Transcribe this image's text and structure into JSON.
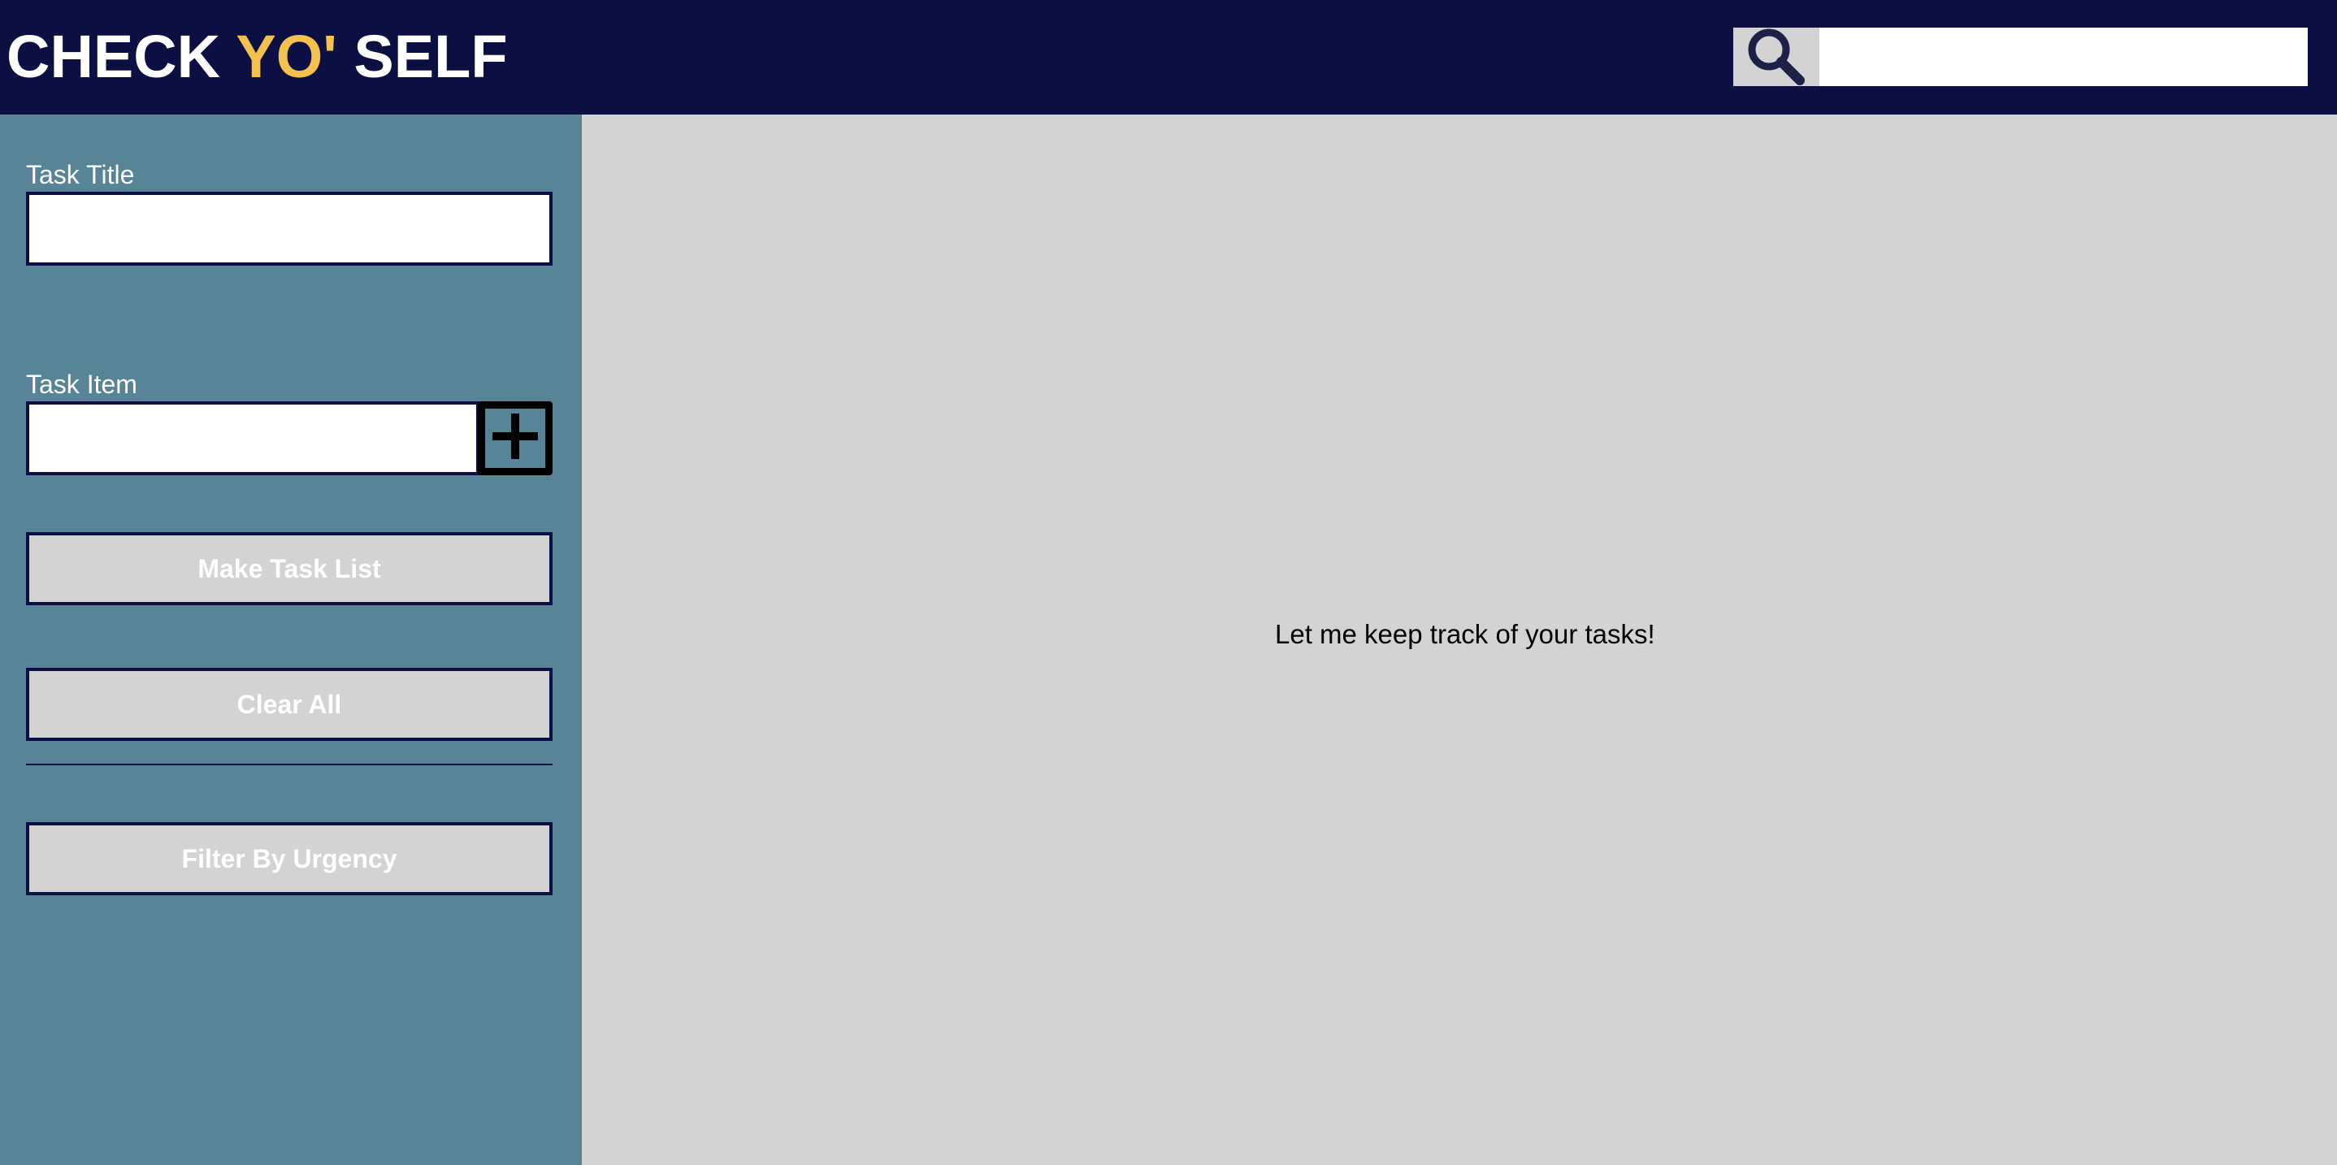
{
  "header": {
    "brand_part1": "CHECK ",
    "brand_accent": "YO'",
    "brand_part2": " SELF",
    "search": {
      "placeholder": "",
      "value": "",
      "icon": "search-icon"
    }
  },
  "sidebar": {
    "task_title_label": "Task Title",
    "task_title_value": "",
    "task_item_label": "Task Item",
    "task_item_value": "",
    "add_item_icon": "plus-icon",
    "make_task_list_label": "Make Task List",
    "clear_all_label": "Clear All",
    "filter_label": "Filter By Urgency"
  },
  "main": {
    "empty_message": "Let me keep track of your tasks!"
  },
  "colors": {
    "header_bg": "#0c0f41",
    "brand_accent": "#f2c14e",
    "sidebar_bg": "#578497",
    "main_bg": "#d3d3d3"
  }
}
